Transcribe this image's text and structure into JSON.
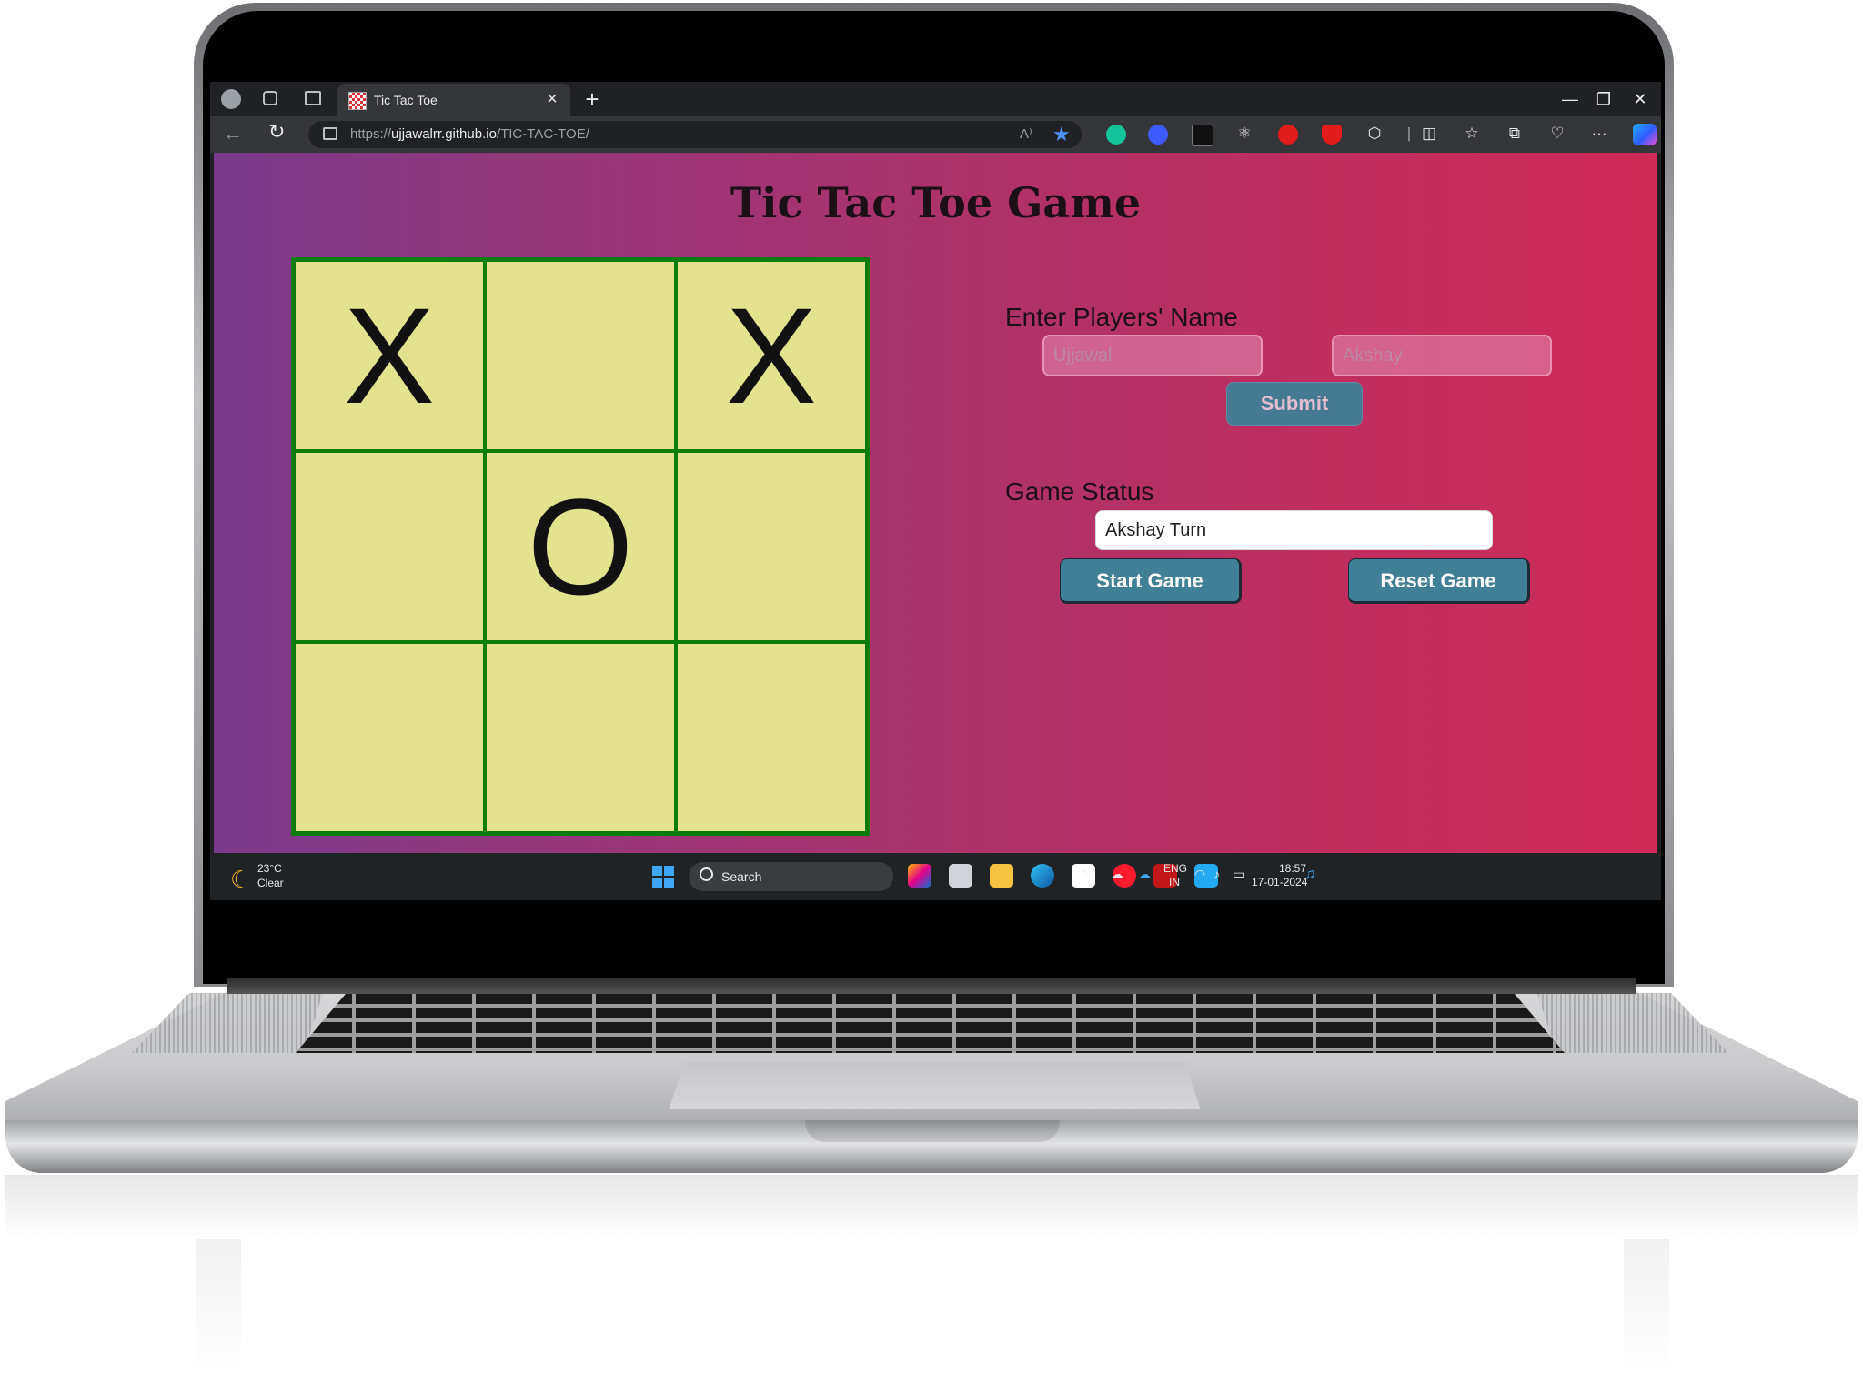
{
  "browser": {
    "tab_title": "Tic Tac Toe",
    "tab_close": "×",
    "new_tab": "+",
    "url_scheme": "https://",
    "url_host": "ujjawalrr.github.io",
    "url_path": "/TIC-TAC-TOE/",
    "read_aloud": "A⁾",
    "more": "···",
    "minimize": "—",
    "maximize": "❐",
    "close": "✕"
  },
  "page": {
    "title": "Tic Tac Toe Game",
    "board": [
      "X",
      "",
      "X",
      "",
      "O",
      "",
      "",
      "",
      ""
    ],
    "players_label": "Enter Players' Name",
    "player1_placeholder": "Ujjawal",
    "player2_placeholder": "Akshay",
    "submit_label": "Submit",
    "status_label": "Game Status",
    "status_value": "Akshay Turn",
    "start_label": "Start Game",
    "reset_label": "Reset Game"
  },
  "taskbar": {
    "temperature": "23°C",
    "condition": "Clear",
    "search": "Search",
    "lang_top": "ENG",
    "lang_bottom": "IN",
    "time": "18:57",
    "date": "17-01-2024"
  },
  "colors": {
    "board_fill": "#e3e28f",
    "board_lines": "#0c7d0a",
    "button": "#3f7f97",
    "page_gradient_start": "#7a3a8c",
    "page_gradient_end": "#cf2a58"
  }
}
